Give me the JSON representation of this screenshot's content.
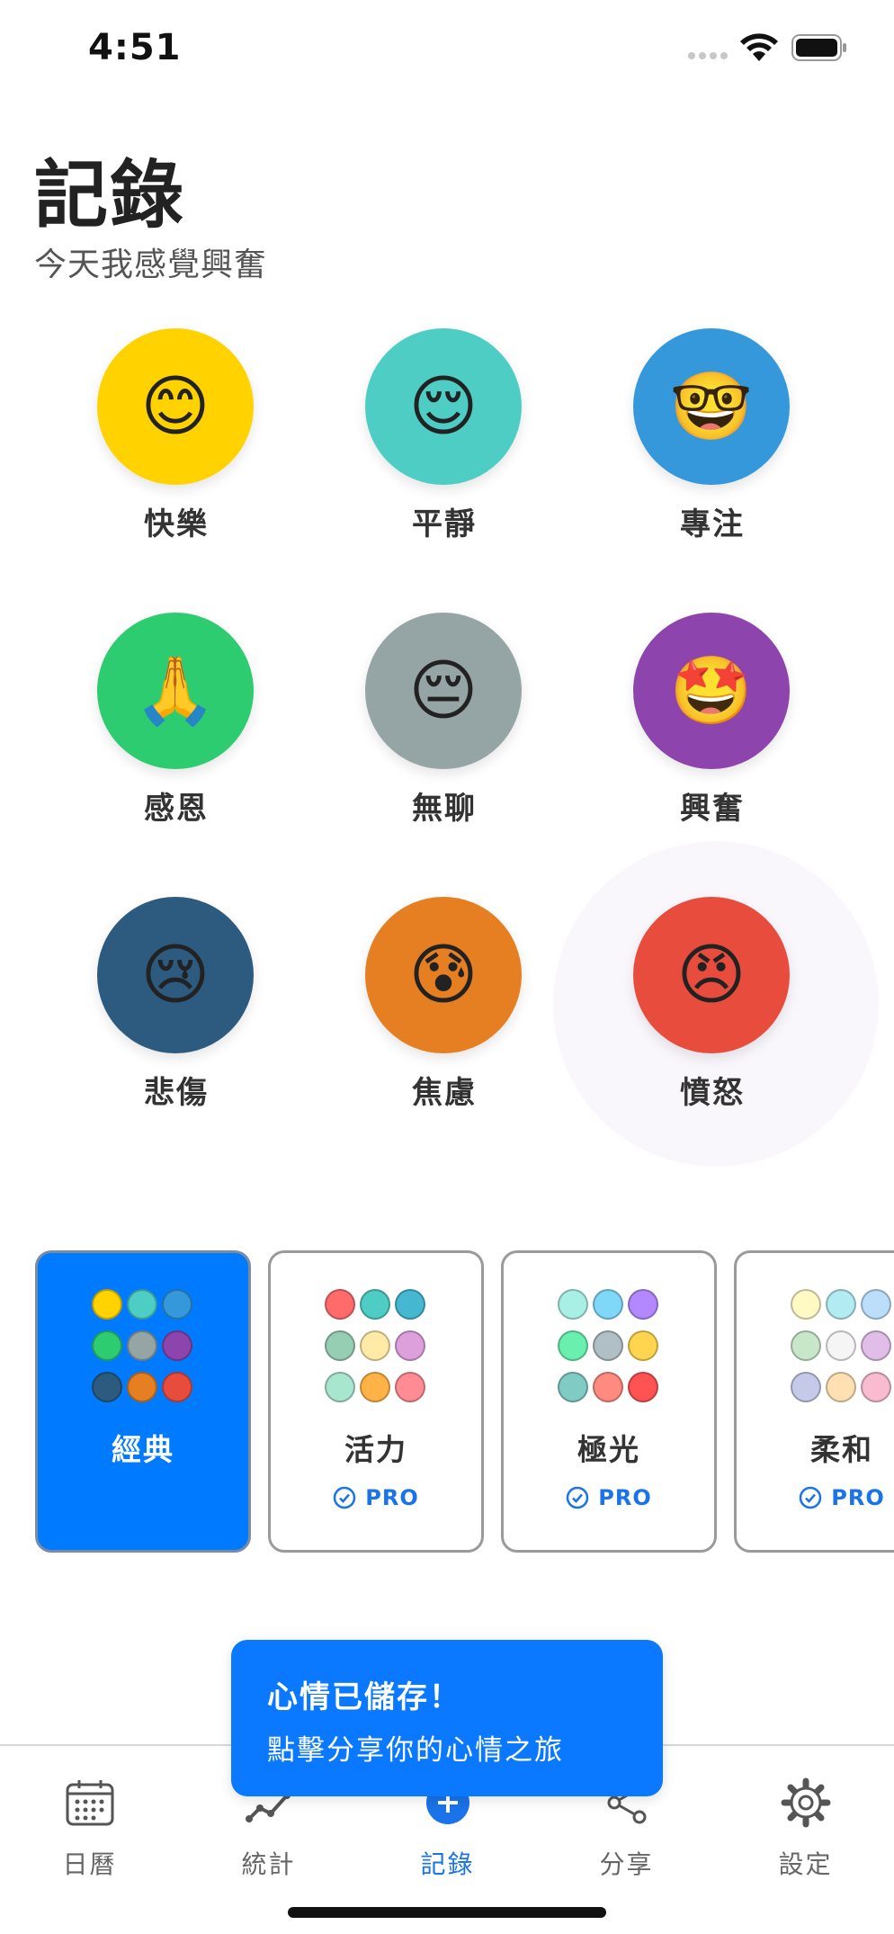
{
  "status_bar": {
    "time": "4:51"
  },
  "header": {
    "title": "記錄",
    "subtitle": "今天我感覺興奮"
  },
  "moods": [
    {
      "label": "快樂",
      "emoji": "😊",
      "color": "#FFD200"
    },
    {
      "label": "平靜",
      "emoji": "😌",
      "color": "#4ECDC4"
    },
    {
      "label": "專注",
      "emoji": "🤓",
      "color": "#3498DB"
    },
    {
      "label": "感恩",
      "emoji": "🙏",
      "color": "#2ECC71"
    },
    {
      "label": "無聊",
      "emoji": "😔",
      "color": "#95A5A6"
    },
    {
      "label": "興奮",
      "emoji": "🤩",
      "color": "#8E44AD"
    },
    {
      "label": "悲傷",
      "emoji": "😢",
      "color": "#2C5B7F"
    },
    {
      "label": "焦慮",
      "emoji": "😰",
      "color": "#E67E22"
    },
    {
      "label": "憤怒",
      "emoji": "😠",
      "color": "#E74C3C"
    }
  ],
  "themes": [
    {
      "name": "經典",
      "selected": true,
      "badge": "",
      "colors": [
        "#FFD200",
        "#4ECDC4",
        "#3498DB",
        "#2ECC71",
        "#95A5A6",
        "#8E44AD",
        "#2C5B7F",
        "#E67E22",
        "#E74C3C"
      ]
    },
    {
      "name": "活力",
      "selected": false,
      "badge": "PRO",
      "colors": [
        "#FF6B6B",
        "#4ECDC4",
        "#45B7D1",
        "#96CEB4",
        "#FFEAA7",
        "#DDA0DD",
        "#A8E6CF",
        "#FFB347",
        "#FF8C94"
      ]
    },
    {
      "name": "極光",
      "selected": false,
      "badge": "PRO",
      "colors": [
        "#A8F0E6",
        "#7FD8F8",
        "#B388FF",
        "#69F0AE",
        "#B0BEC5",
        "#FFD54F",
        "#80CBC4",
        "#FF8A80",
        "#FF5252"
      ]
    },
    {
      "name": "柔和",
      "selected": false,
      "badge": "PRO",
      "colors": [
        "#FFF9C4",
        "#B2EBF2",
        "#BBDEFB",
        "#C8E6C9",
        "#F5F5F5",
        "#E1BEE7",
        "#C5CAE9",
        "#FFE0B2",
        "#F8BBD0"
      ]
    }
  ],
  "toast": {
    "title": "心情已儲存！",
    "message": "點擊分享你的心情之旅"
  },
  "tabs": [
    {
      "label": "日曆",
      "icon": "calendar-icon",
      "active": false
    },
    {
      "label": "統計",
      "icon": "chart-icon",
      "active": false
    },
    {
      "label": "記錄",
      "icon": "plus-icon",
      "active": true
    },
    {
      "label": "分享",
      "icon": "share-icon",
      "active": false
    },
    {
      "label": "設定",
      "icon": "gear-icon",
      "active": false
    }
  ],
  "colors": {
    "accent": "#007AFF",
    "tab_inactive": "#666666"
  }
}
